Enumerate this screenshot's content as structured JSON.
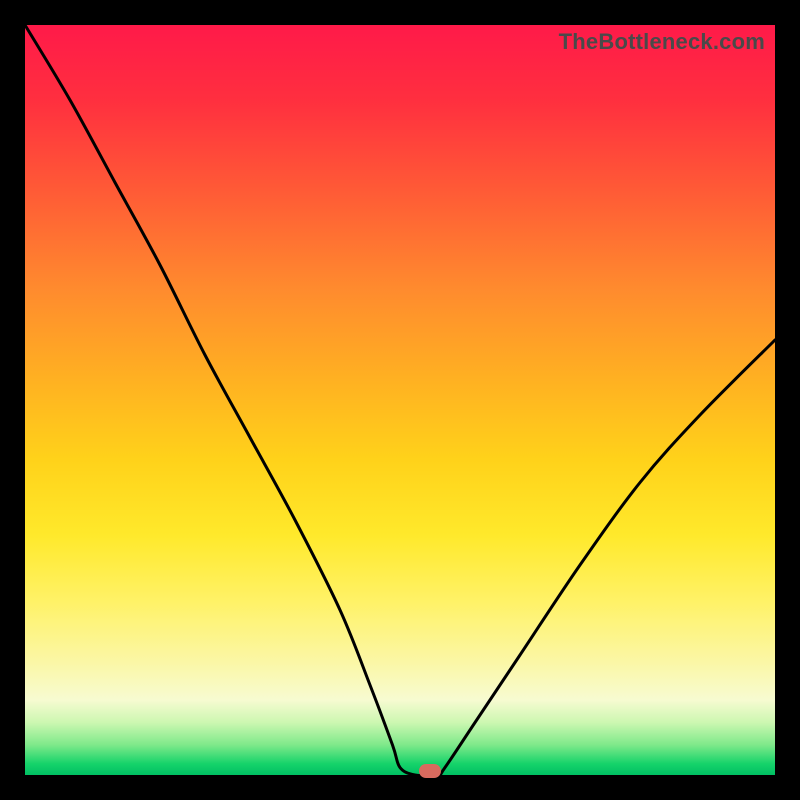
{
  "watermark": "TheBottleneck.com",
  "chart_data": {
    "type": "line",
    "title": "",
    "xlabel": "",
    "ylabel": "",
    "xlim": [
      0,
      100
    ],
    "ylim": [
      0,
      100
    ],
    "x": [
      0,
      6,
      12,
      18,
      24,
      30,
      36,
      42,
      46,
      49,
      50,
      52,
      55,
      56,
      60,
      66,
      74,
      82,
      90,
      100
    ],
    "values": [
      100,
      90,
      79,
      68,
      56,
      45,
      34,
      22,
      12,
      4,
      1,
      0,
      0,
      1,
      7,
      16,
      28,
      39,
      48,
      58
    ],
    "marker": {
      "x": 54,
      "y": 0.5
    },
    "gradient_stops": [
      {
        "pos": 0,
        "color": "#ff1a49"
      },
      {
        "pos": 0.5,
        "color": "#ffd21a"
      },
      {
        "pos": 0.9,
        "color": "#f7fbd1"
      },
      {
        "pos": 1.0,
        "color": "#00bf63"
      }
    ]
  }
}
